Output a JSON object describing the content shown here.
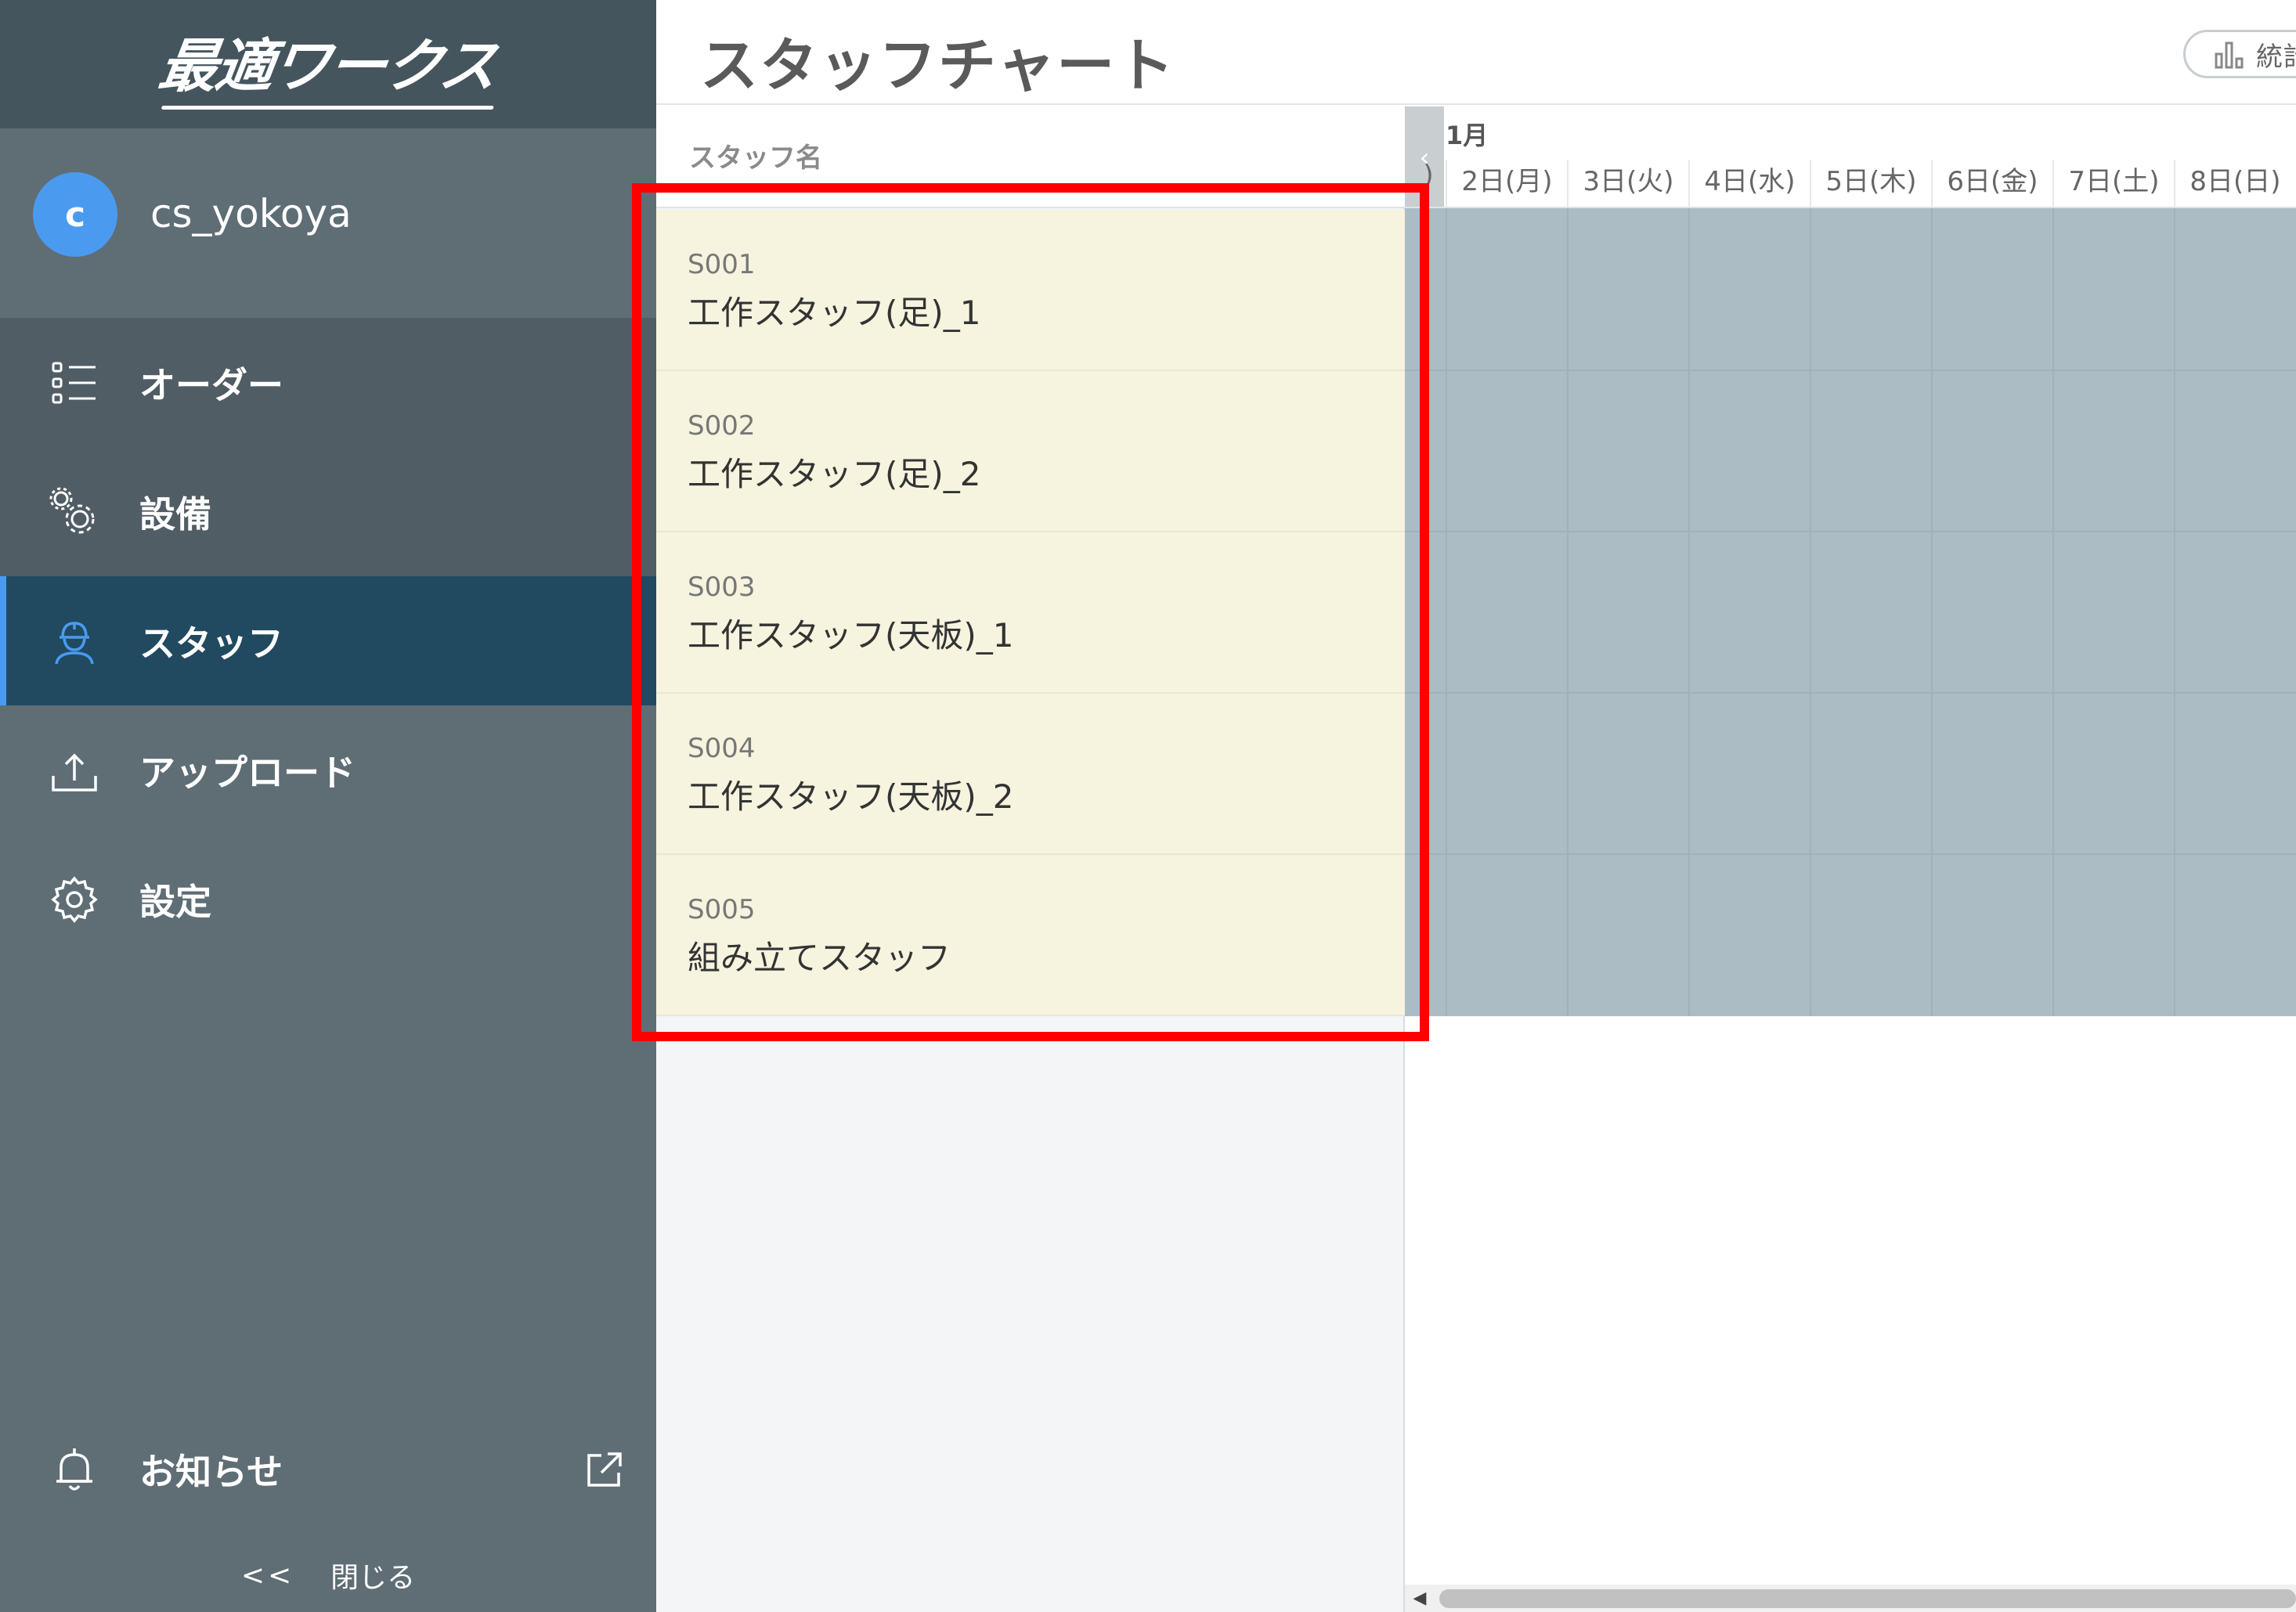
{
  "app": {
    "logo": "最適ワークス",
    "user": {
      "initial": "c",
      "name": "cs_yokoya"
    }
  },
  "sidebar": {
    "items": [
      {
        "label": "オーダー",
        "icon": "list-icon"
      },
      {
        "label": "設備",
        "icon": "gears-icon"
      },
      {
        "label": "スタッフ",
        "icon": "worker-icon",
        "active": true
      },
      {
        "label": "アップロード",
        "icon": "upload-icon"
      },
      {
        "label": "設定",
        "icon": "gear-icon"
      }
    ],
    "notice": {
      "label": "お知らせ",
      "icon": "bell-icon",
      "external_icon": "external-link-icon"
    },
    "collapse": {
      "chevron": "<<",
      "label": "閉じる"
    }
  },
  "header": {
    "title": "スタッフチャート",
    "stats_button_label": "統計",
    "stats_icon": "bar-chart-icon"
  },
  "staff_column": {
    "header": "スタッフ名",
    "rows": [
      {
        "code": "S001",
        "name": "工作スタッフ(足)_1"
      },
      {
        "code": "S002",
        "name": "工作スタッフ(足)_2"
      },
      {
        "code": "S003",
        "name": "工作スタッフ(天板)_1"
      },
      {
        "code": "S004",
        "name": "工作スタッフ(天板)_2"
      },
      {
        "code": "S005",
        "name": "組み立てスタッフ"
      }
    ]
  },
  "chart": {
    "collapse_icon": "chevron-left-icon",
    "month": "1月",
    "first_day_fragment": ")",
    "days": [
      "2日(月)",
      "3日(火)",
      "4日(水)",
      "5日(木)",
      "6日(金)",
      "7日(土)",
      "8日(日)"
    ]
  },
  "colors": {
    "sidebar_bg": "#5f6d75",
    "active_bg": "#214a60",
    "accent": "#4a9bf0",
    "staff_row_bg": "#f6f3df",
    "grid_bg": "#abbcc5",
    "highlight": "#ff0000"
  }
}
